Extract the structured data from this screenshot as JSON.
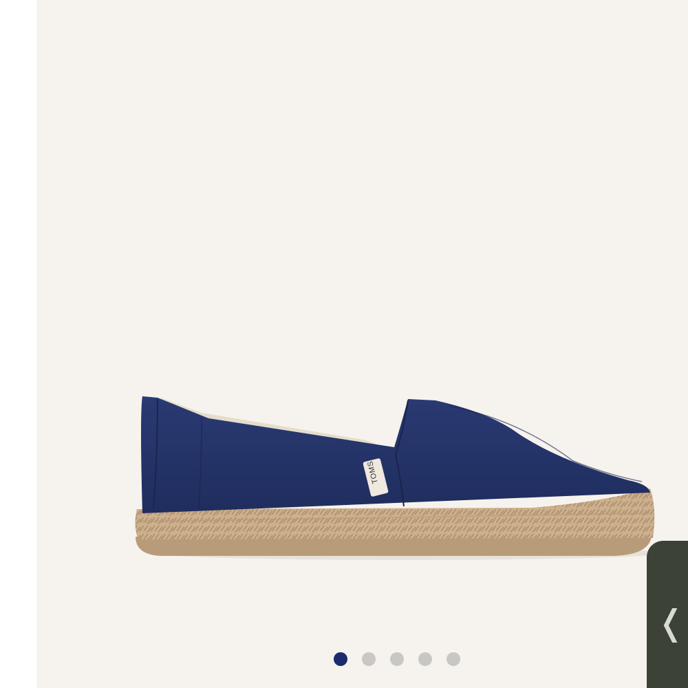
{
  "product": {
    "brand_label": "TOMS",
    "colors": {
      "canvas": "#26356b",
      "jute": "#cdb08e",
      "background": "#f6f3ee"
    }
  },
  "carousel": {
    "total_slides": 5,
    "active_index": 0,
    "active_color": "#1d2a6e",
    "inactive_color": "#c9c7c4"
  },
  "side_handle": {
    "icon": "chevron-left-icon",
    "glyph": "❬"
  }
}
